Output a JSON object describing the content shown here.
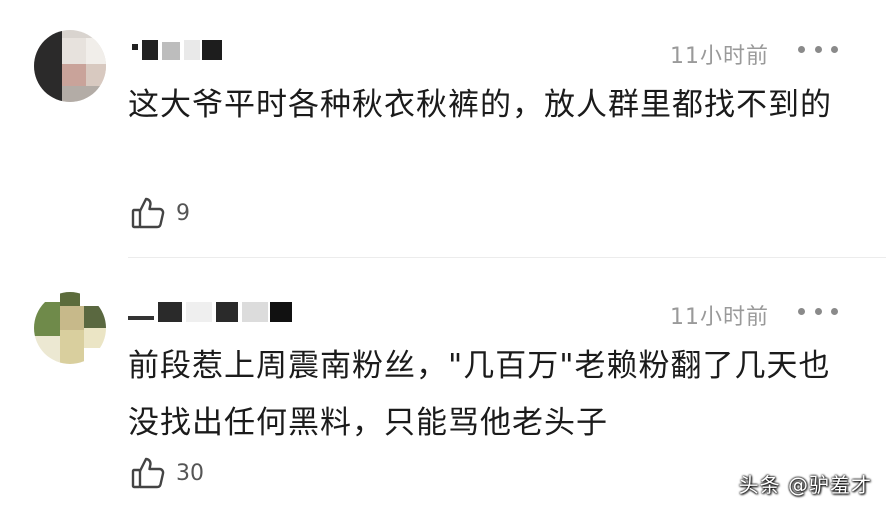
{
  "comments": [
    {
      "time": "11小时前",
      "text": "这大爷平时各种秋衣秋裤的，放人群里都找不到的",
      "likes": "9"
    },
    {
      "time": "11小时前",
      "text": "前段惹上周震南粉丝，\"几百万\"老赖粉翻了几天也没找出任何黑料，只能骂他老头子",
      "likes": "30"
    }
  ],
  "watermark": "头条 @驴羞才",
  "icons": {
    "like": "thumbs-up-icon",
    "more": "more-dots-icon"
  }
}
